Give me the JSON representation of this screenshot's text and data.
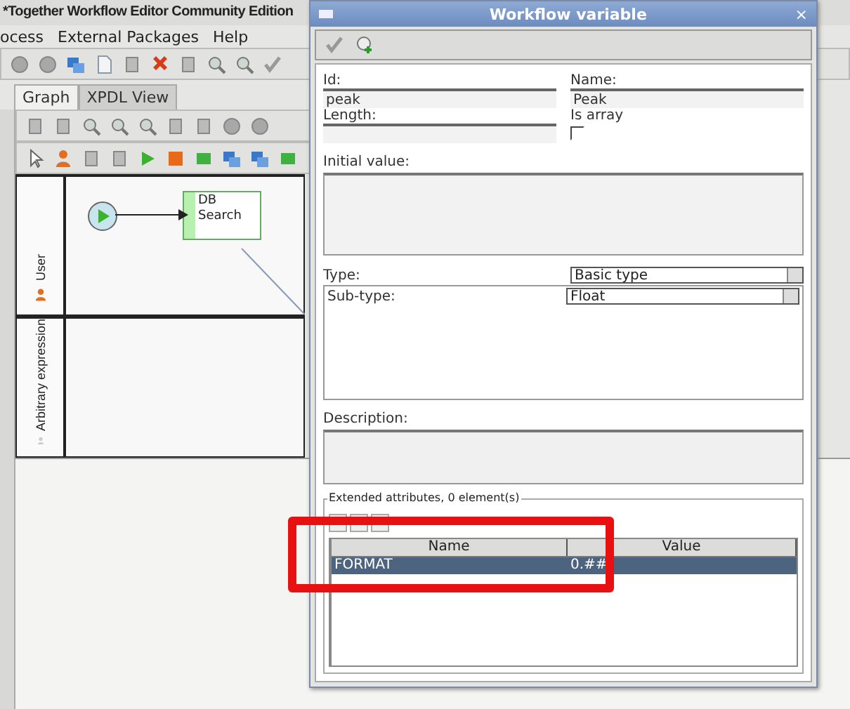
{
  "main_window": {
    "title": "*Together Workflow Editor Community Edition",
    "menu": [
      "ocess",
      "External Packages",
      "Help"
    ],
    "tabs": [
      {
        "label": "Graph",
        "selected": true
      },
      {
        "label": "XPDL View",
        "selected": false
      }
    ],
    "lanes": [
      {
        "label": "User",
        "kind": "person"
      },
      {
        "label": "Arbitrary expression",
        "kind": "expression"
      }
    ],
    "activity": {
      "label": "DB Search"
    }
  },
  "dialog": {
    "title": "Workflow variable",
    "close": "×",
    "id": {
      "label": "Id:",
      "value": "peak"
    },
    "name": {
      "label": "Name:",
      "value": "Peak"
    },
    "length": {
      "label": "Length:"
    },
    "is_array": {
      "label": "Is array",
      "checked": false
    },
    "initial_value": {
      "label": "Initial value:"
    },
    "type": {
      "label": "Type:",
      "value": "Basic type"
    },
    "subtype": {
      "label": "Sub-type:",
      "value": "Float"
    },
    "description": {
      "label": "Description:"
    },
    "extended_attributes": {
      "legend": "Extended attributes, 0 element(s)",
      "columns": [
        "Name",
        "Value"
      ],
      "rows": [
        {
          "cells": [
            "FORMAT",
            "0.##"
          ],
          "selected": true
        }
      ]
    }
  }
}
